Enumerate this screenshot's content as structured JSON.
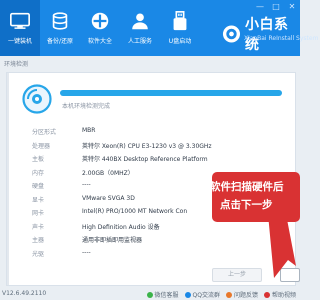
{
  "header": {
    "brand_name": "小白系统",
    "brand_sub": "XiaoBai ReInstall System",
    "window_controls": [
      "—",
      "□",
      "✕"
    ],
    "nav": [
      {
        "label": "一键装机",
        "icon": "monitor-icon",
        "active": true
      },
      {
        "label": "备份/还原",
        "icon": "backup-icon",
        "active": false
      },
      {
        "label": "软件大全",
        "icon": "apps-icon",
        "active": false
      },
      {
        "label": "人工服务",
        "icon": "service-icon",
        "active": false
      },
      {
        "label": "U盘启动",
        "icon": "usb-icon",
        "active": false
      }
    ]
  },
  "subbar": {
    "title": "环境检测"
  },
  "scan": {
    "progress_text": "本机环境检测完成",
    "progress_fraction": 1.0
  },
  "hardware": [
    {
      "label": "分区形式",
      "value": "MBR"
    },
    {
      "label": "处理器",
      "value": "英特尔 Xeon(R) CPU E3-1230 v3 @ 3.30GHz"
    },
    {
      "label": "主板",
      "value": "英特尔 440BX Desktop Reference Platform"
    },
    {
      "label": "内存",
      "value": "2.00GB（0MHZ）"
    },
    {
      "label": "硬盘",
      "value": "----"
    },
    {
      "label": "显卡",
      "value": "VMware SVGA 3D"
    },
    {
      "label": "网卡",
      "value": "Intel(R) PRO/1000 MT Network Con"
    },
    {
      "label": "声卡",
      "value": "High Definition Audio 设备"
    },
    {
      "label": "主器",
      "value": "通用非即插即用监视器"
    },
    {
      "label": "光驱",
      "value": "----"
    }
  ],
  "buttons": {
    "prev": "上一步",
    "next": ""
  },
  "callout": {
    "line1": "软件扫描硬件后",
    "line2": "点击下一步"
  },
  "footer": {
    "version": "V12.6.49.2110",
    "links": [
      {
        "label": "微信客服",
        "color": "#3bb34a"
      },
      {
        "label": "QQ交流群",
        "color": "#1a88e6"
      },
      {
        "label": "问题反馈",
        "color": "#e8782b"
      },
      {
        "label": "帮助视频",
        "color": "#d93233"
      }
    ]
  },
  "colors": {
    "accent": "#1a88e6",
    "callout": "#d93233",
    "progress": "#27a6e9"
  }
}
